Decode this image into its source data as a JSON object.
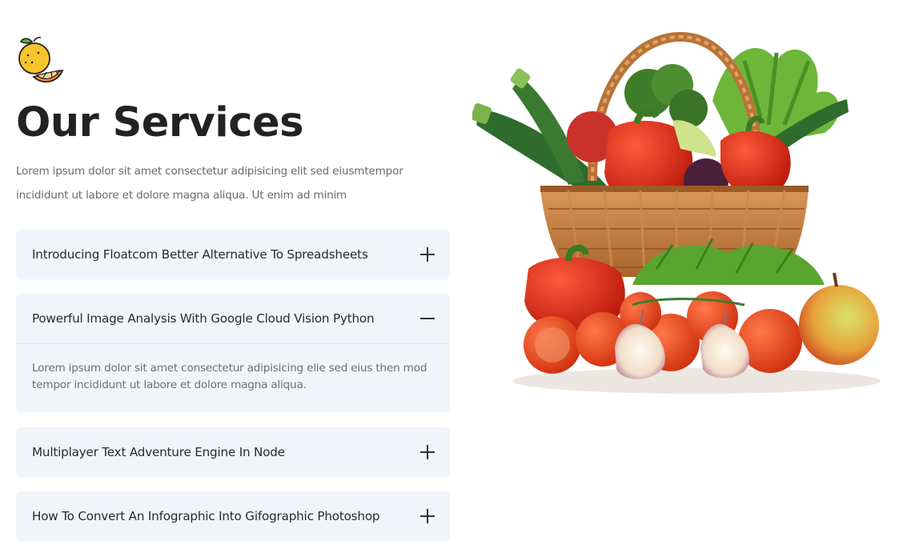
{
  "logo": {
    "icon": "lemon-icon"
  },
  "section": {
    "title": "Our Services",
    "intro": "Lorem ipsum dolor sit amet consectetur adipisicing elit sed eiusmtempor incididunt ut labore et dolore magna aliqua. Ut enim ad minim"
  },
  "faq": [
    {
      "question": "Introducing Floatcom Better Alternative To Spreadsheets",
      "expanded": false,
      "icon": "plus-icon"
    },
    {
      "question": "Powerful Image Analysis With Google Cloud Vision Python",
      "expanded": true,
      "icon": "minus-icon",
      "answer": "Lorem ipsum dolor sit amet consectetur adipisicing elie sed eius then mod tempor incididunt ut labore et dolore magna aliqua."
    },
    {
      "question": "Multiplayer Text Adventure Engine In Node",
      "expanded": false,
      "icon": "plus-icon"
    },
    {
      "question": "How To Convert An Infographic Into Gifographic Photoshop",
      "expanded": false,
      "icon": "plus-icon"
    }
  ],
  "hero_image": {
    "icon": "vegetable-basket-image"
  },
  "colors": {
    "accordion_bg": "#f1f5fa",
    "title": "#222222",
    "body_text": "#6a6a6a",
    "lemon": "#f7c52b",
    "tomato": "#e2401f"
  }
}
